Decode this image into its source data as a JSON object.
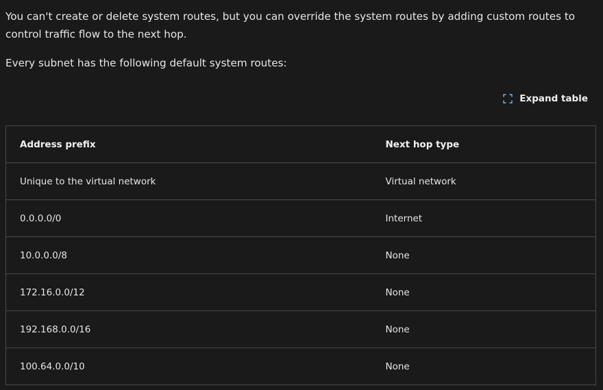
{
  "content": {
    "intro_text": "You can't create or delete system routes, but you can override the system routes by adding custom routes to control traffic flow to the next hop.",
    "subnet_text": "Every subnet has the following default system routes:"
  },
  "expand_table": {
    "label": "Expand table",
    "icon": "expand-icon",
    "icon_color": "#75b6e7"
  },
  "table": {
    "headers": {
      "address_prefix": "Address prefix",
      "next_hop_type": "Next hop type"
    },
    "rows": [
      {
        "address_prefix": "Unique to the virtual network",
        "next_hop_type": "Virtual network"
      },
      {
        "address_prefix": "0.0.0.0/0",
        "next_hop_type": "Internet"
      },
      {
        "address_prefix": "10.0.0.0/8",
        "next_hop_type": "None"
      },
      {
        "address_prefix": "172.16.0.0/12",
        "next_hop_type": "None"
      },
      {
        "address_prefix": "192.168.0.0/16",
        "next_hop_type": "None"
      },
      {
        "address_prefix": "100.64.0.0/10",
        "next_hop_type": "None"
      }
    ]
  },
  "colors": {
    "background": "#1a1a1a",
    "text": "#e6e6e6",
    "border": "#4a4a4a"
  }
}
